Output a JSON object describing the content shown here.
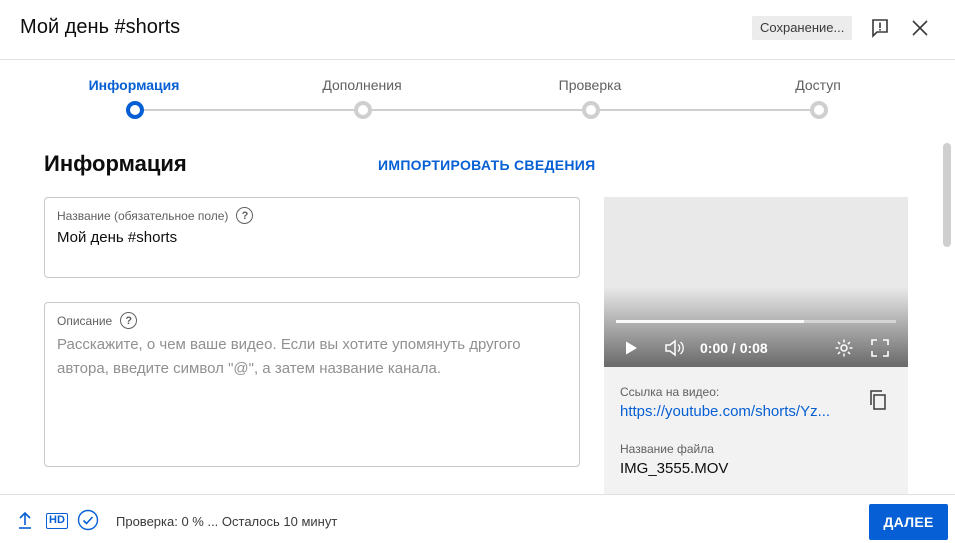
{
  "header": {
    "title": "Мой день #shorts",
    "saving_label": "Сохранение...",
    "feedback_icon": "feedback-icon",
    "close_icon": "close-icon"
  },
  "stepper": {
    "steps": [
      {
        "label": "Информация",
        "active": true
      },
      {
        "label": "Дополнения",
        "active": false
      },
      {
        "label": "Проверка",
        "active": false
      },
      {
        "label": "Доступ",
        "active": false
      }
    ]
  },
  "section": {
    "title": "Информация",
    "import_label": "ИМПОРТИРОВАТЬ СВЕДЕНИЯ"
  },
  "title_field": {
    "label": "Название (обязательное поле)",
    "value": "Мой день #shorts"
  },
  "description_field": {
    "label": "Описание",
    "placeholder": "Расскажите, о чем ваше видео. Если вы хотите упомянуть другого автора, введите символ \"@\", а затем название канала."
  },
  "video": {
    "time": "0:00 / 0:08",
    "progress": 0.67,
    "link_label": "Ссылка на видео:",
    "link_value": "https://youtube.com/shorts/Yz...",
    "filename_label": "Название файла",
    "filename_value": "IMG_3555.MOV"
  },
  "footer": {
    "hd_label": "HD",
    "status": "Проверка: 0 % ... Осталось 10 минут",
    "next_label": "ДАЛЕЕ"
  },
  "colors": {
    "accent": "#065fd4",
    "text": "#0d0d0d",
    "muted": "#606060",
    "border": "#c8c8c8"
  }
}
